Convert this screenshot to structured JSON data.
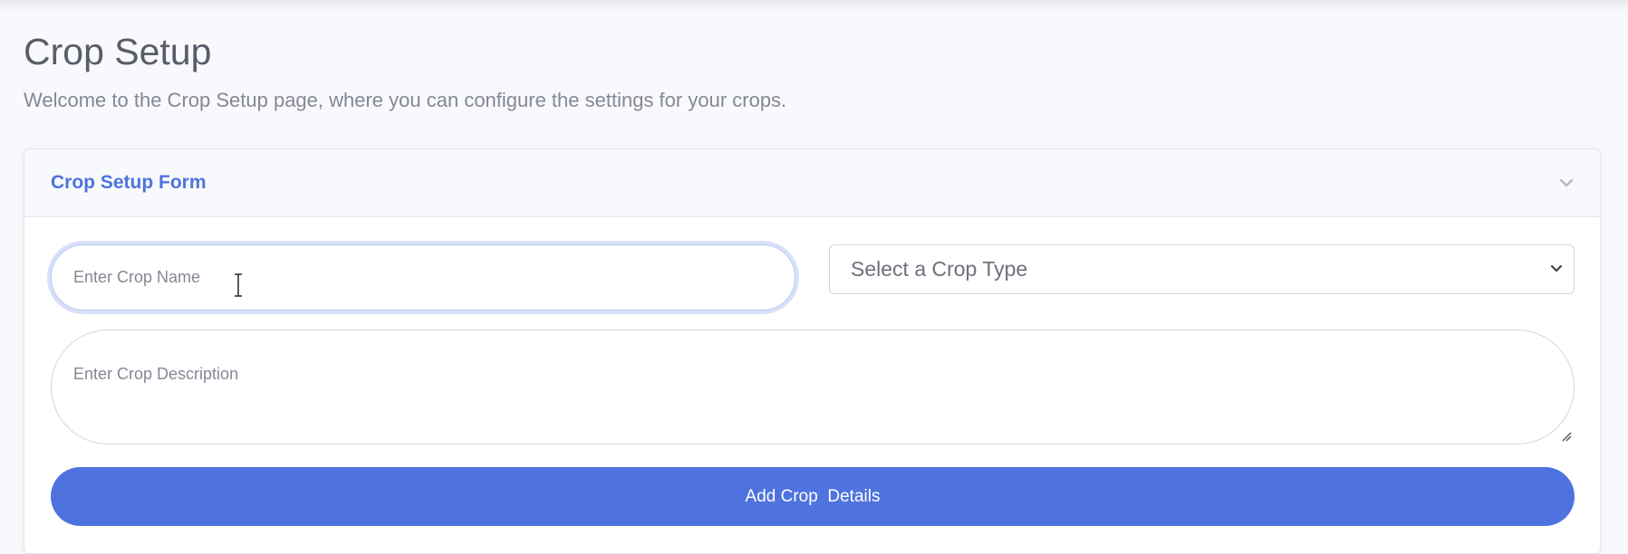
{
  "page": {
    "title": "Crop Setup",
    "subtitle": "Welcome to the Crop Setup page, where you can configure the settings for your crops."
  },
  "card": {
    "title": "Crop Setup Form",
    "collapse_icon": "chevron-down-icon"
  },
  "form": {
    "crop_name": {
      "value": "",
      "placeholder": "Enter Crop Name"
    },
    "crop_type": {
      "selected": "Select a Crop Type",
      "icon": "chevron-down-icon"
    },
    "crop_description": {
      "value": "",
      "placeholder": "Enter Crop Description"
    },
    "submit_label": "Add Crop  Details"
  },
  "colors": {
    "accent": "#4e73df",
    "text": "#5a5c69",
    "muted": "#858796",
    "background": "#f8f9fc"
  }
}
